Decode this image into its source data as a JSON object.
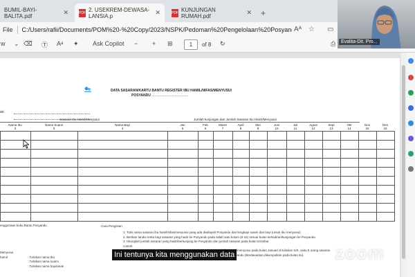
{
  "tabs": [
    {
      "label": "BUMIL-BAYI-BALITA.pdf",
      "active": false
    },
    {
      "label": "2. USEKREM-DEWASA-LANSIA.p",
      "active": true
    },
    {
      "label": "KUNJUNGAN RUMAH.pdf",
      "active": false
    }
  ],
  "address": {
    "file_label": "File",
    "url": "C:/Users/rafii/Documents/POM%20-%20Copy/2023/NSPK/Pedoman%20Pengelolaan%20Posyandu/Panduan%..."
  },
  "toolbar": {
    "ask_copilot": "Ask Copilot",
    "page_current": "1",
    "page_total": "of 8"
  },
  "document": {
    "title": "DATA SASARAN/KARTU BANTU REGISTER IBU HAMIL/NIFAS/MENYUSUI",
    "posyandu_label": "POSYANDU",
    "left_label": "ari",
    "group_left": "Sasaran Ibu Hamil/Menyusui",
    "group_right": "Jumlah kunjungan dan Jumlah Sasaran Ibu Hamil/Menyusui",
    "columns": [
      {
        "label": "Nama Ibu",
        "num": "2"
      },
      {
        "label": "Nama Suami",
        "num": "3"
      },
      {
        "label": "Nama Bayi",
        "num": "4"
      },
      {
        "label": "Jan",
        "num": "5"
      },
      {
        "label": "Feb",
        "num": "6"
      },
      {
        "label": "Maret",
        "num": "7"
      },
      {
        "label": "April",
        "num": "8"
      },
      {
        "label": "Mei",
        "num": "9"
      },
      {
        "label": "Juni",
        "num": "10"
      },
      {
        "label": "Juli",
        "num": "11"
      },
      {
        "label": "Agust",
        "num": "12"
      },
      {
        "label": "Sept",
        "num": "13"
      },
      {
        "label": "Okt",
        "num": "14"
      },
      {
        "label": "Nov",
        "num": "15"
      },
      {
        "label": "Des",
        "num": "16"
      }
    ],
    "notes_left_title": "enggunaan buku Bantu Posyandu",
    "notes_left": [
      {
        "label": "Menyusui",
        "value": ""
      },
      {
        "label": "hamil",
        "value": ": Tuliskan nama Ibu"
      },
      {
        "label": "",
        "value": ": Tuliskan nama suami"
      },
      {
        "label": "",
        "value": ": Tuliskan nama bayi/anak"
      }
    ],
    "notes_right_title": "Cara Pengisian",
    "notes_right": [
      "1. Tulis nama sasaran ibu hamil/nifas/menyusui yang ada diwilayah Posyandu dan lengkapi suami dan bayi (untuk ibu menyusui)",
      "2. Berikan tanda centa bagi sasaran yang hadir ke Posyandu pada salah satu kolom (5-15) sesuai bulan kehadiran/kunjungan ke Posyandu",
      "3. Hitunglah jumlah sasaran yang hadir/berkunjung ke Posyandu dan jumlah sasaran pada bulan tersebut",
      "contoh",
      "Nama jumlah sasaran yang berkunjung ke Posyandu dan sumberdaerah ibu hamil/menyusui pada bulan Januari di tuliskan S/K, saitu 5 orang sasaran",
      "yang hadir ke Posyandu dan 8 jumlah sasaran ibu hamil/menyusui di wilayah Posyandu (Berdasarkan dikumpulkan pada bulan itu)"
    ]
  },
  "video": {
    "participant_name": "Evalita-Dit. Pro..."
  },
  "caption": "Ini tentunya kita menggunakan data",
  "zoom_logo": "zoom"
}
